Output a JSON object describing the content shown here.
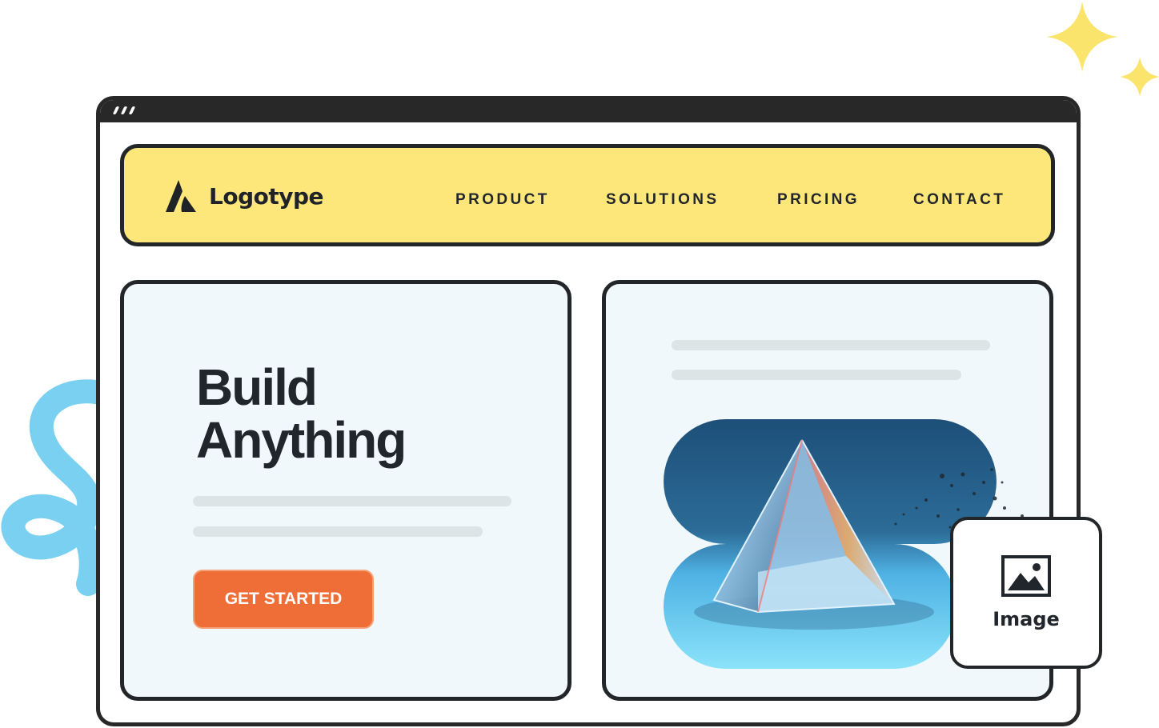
{
  "nav": {
    "logo_text": "Logotype",
    "items": [
      {
        "label": "PRODUCT"
      },
      {
        "label": "SOLUTIONS"
      },
      {
        "label": "PRICING"
      },
      {
        "label": "CONTACT"
      }
    ]
  },
  "hero": {
    "headline_line1": "Build",
    "headline_line2": "Anything",
    "cta_label": "GET STARTED"
  },
  "image_badge": {
    "label": "Image",
    "icon": "image-icon"
  },
  "colors": {
    "nav_bg": "#fde77a",
    "card_bg": "#f0f8fb",
    "cta_bg": "#ef6d37",
    "frame": "#282828",
    "sparkle": "#fbe46b",
    "scribble": "#79d0f0"
  }
}
